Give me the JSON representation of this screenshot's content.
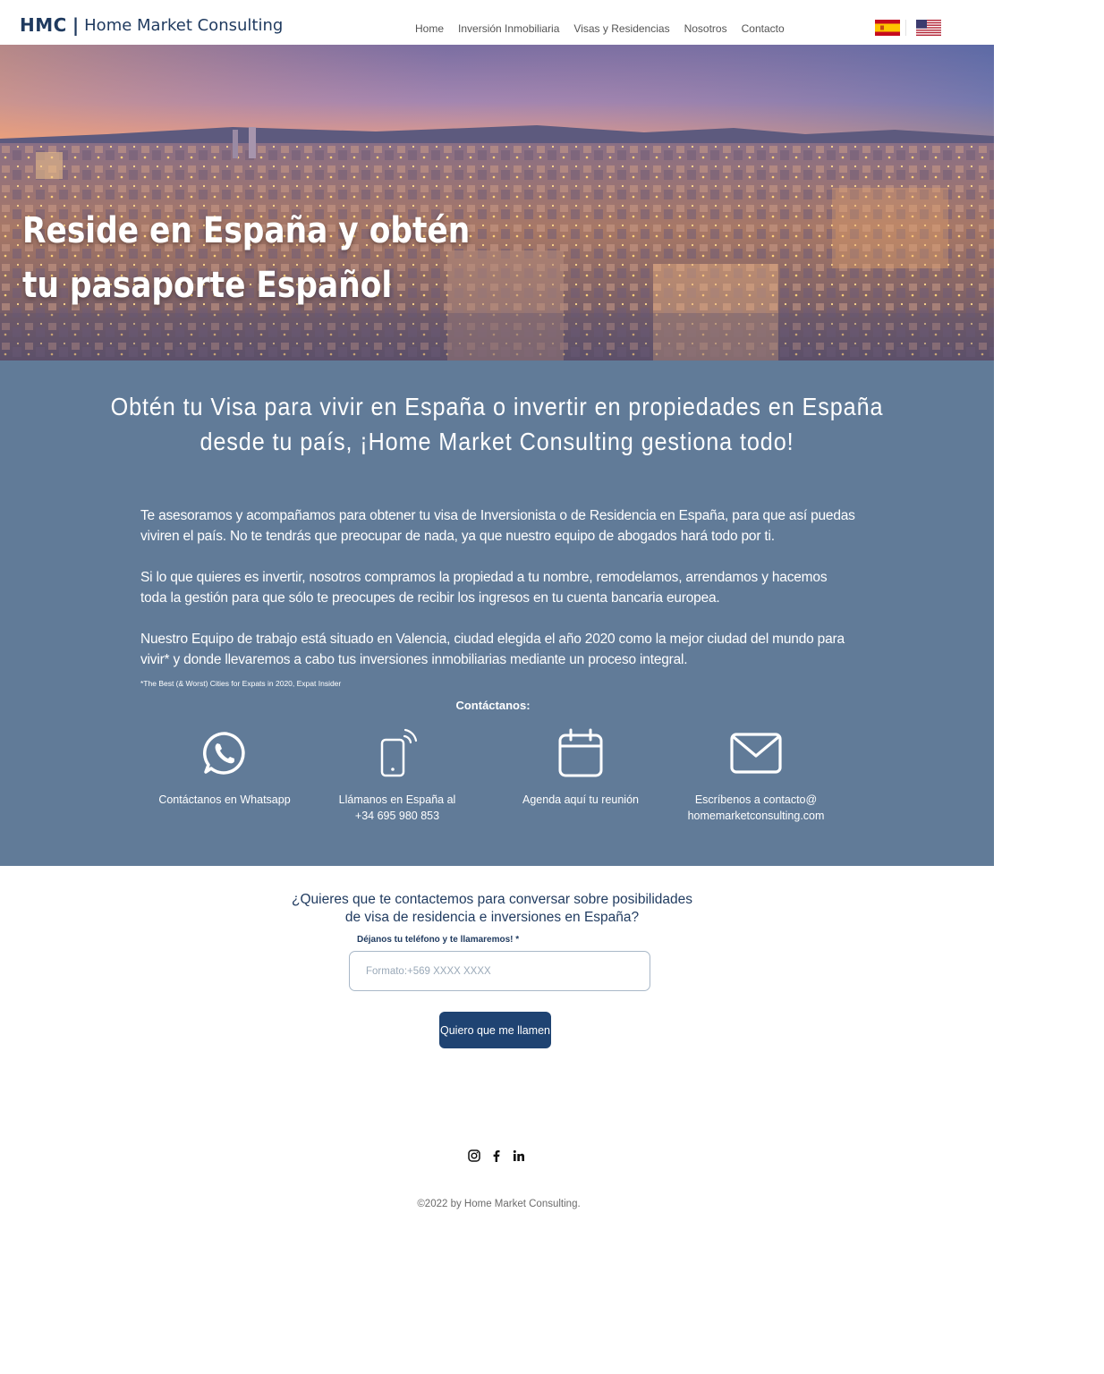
{
  "header": {
    "logo_abbr": "HMC",
    "logo_separator": "|",
    "logo_full": "Home Market Consulting",
    "nav": [
      "Home",
      "Inversión Inmobiliaria",
      "Visas y Residencias",
      "Nosotros",
      "Contacto"
    ],
    "languages": [
      "spain-flag-icon",
      "usa-flag-icon"
    ]
  },
  "hero": {
    "title_line1": "Reside en España y obtén",
    "title_line2": "tu pasaporte Español"
  },
  "info": {
    "title_line1": "Obtén tu Visa para vivir en España o invertir en propiedades en España",
    "title_line2": "desde tu país, ¡Home Market Consulting gestiona todo!",
    "paragraph1": "Te asesoramos y acompañamos para obtener tu visa de Inversionista o de Residencia en España, para que así puedas viviren el país. No te tendrás que preocupar de nada, ya que nuestro equipo de abogados hará todo por ti.",
    "paragraph2": "Si lo que quieres es invertir, nosotros compramos la propiedad a tu nombre, remodelamos, arrendamos y hacemos toda la gestión para que sólo te preocupes de recibir los ingresos en tu cuenta bancaria europea.",
    "paragraph3": "Nuestro Equipo de trabajo está situado en Valencia, ciudad elegida el año 2020 como la mejor ciudad del mundo para vivir* y donde llevaremos a cabo tus inversiones inmobiliarias mediante un proceso integral.",
    "footnote": "*The Best (& Worst) Cities for Expats in 2020, Expat Insider",
    "contact_heading": "Contáctanos:",
    "contacts": [
      {
        "icon": "whatsapp-icon",
        "line1": "Contáctanos en Whatsapp",
        "line2": ""
      },
      {
        "icon": "phone-icon",
        "line1": "Llámanos en España al",
        "line2": "+34 695 980 853"
      },
      {
        "icon": "calendar-icon",
        "line1": "Agenda aquí tu reunión",
        "line2": ""
      },
      {
        "icon": "mail-icon",
        "line1": "Escríbenos a contacto@",
        "line2": "homemarketconsulting.com"
      }
    ]
  },
  "form": {
    "question": "¿Quieres que te contactemos para conversar sobre posibilidades de visa de residencia e inversiones en España?",
    "label": "Déjanos tu teléfono y te llamaremos! *",
    "placeholder": "Formato:+569 XXXX XXXX",
    "value": "",
    "submit_label": "Quiero que me llamen"
  },
  "footer": {
    "social": [
      "instagram-icon",
      "facebook-icon",
      "linkedin-icon"
    ],
    "copyright": "©2022 by Home Market Consulting."
  },
  "colors": {
    "brand_dark": "#1f3a5f",
    "section_blue": "#617b98",
    "button_blue": "#1f4372"
  }
}
